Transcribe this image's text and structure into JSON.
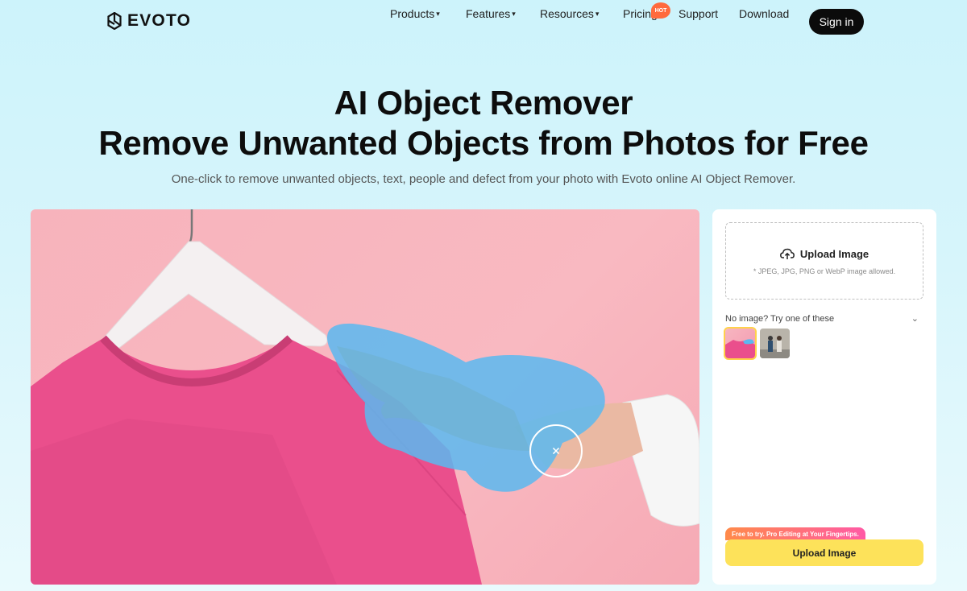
{
  "brand": {
    "name": "EVOTO"
  },
  "nav": {
    "products": "Products",
    "features": "Features",
    "resources": "Resources",
    "pricing": "Pricing",
    "hot_badge": "HOT",
    "support": "Support",
    "download": "Download",
    "signin": "Sign in",
    "caret": "▾"
  },
  "hero": {
    "title_line1": "AI Object Remover",
    "title_line2": "Remove Unwanted Objects from Photos for Free",
    "subtitle": "One-click to remove unwanted objects, text, people and defect from your photo with Evoto online AI Object Remover."
  },
  "panel": {
    "upload_label": "Upload Image",
    "upload_hint": "* JPEG, JPG, PNG or WebP image allowed.",
    "try_label": "No image? Try one of these",
    "chevron": "⌄",
    "promo": "Free to try. Pro Editing at Your Fingertips.",
    "upload_button": "Upload Image"
  },
  "colors": {
    "accent_yellow": "#fde25a",
    "brush_blue": "#5bb8f0",
    "shirt_pink": "#e84d8a",
    "background": "#d7f5fb"
  }
}
